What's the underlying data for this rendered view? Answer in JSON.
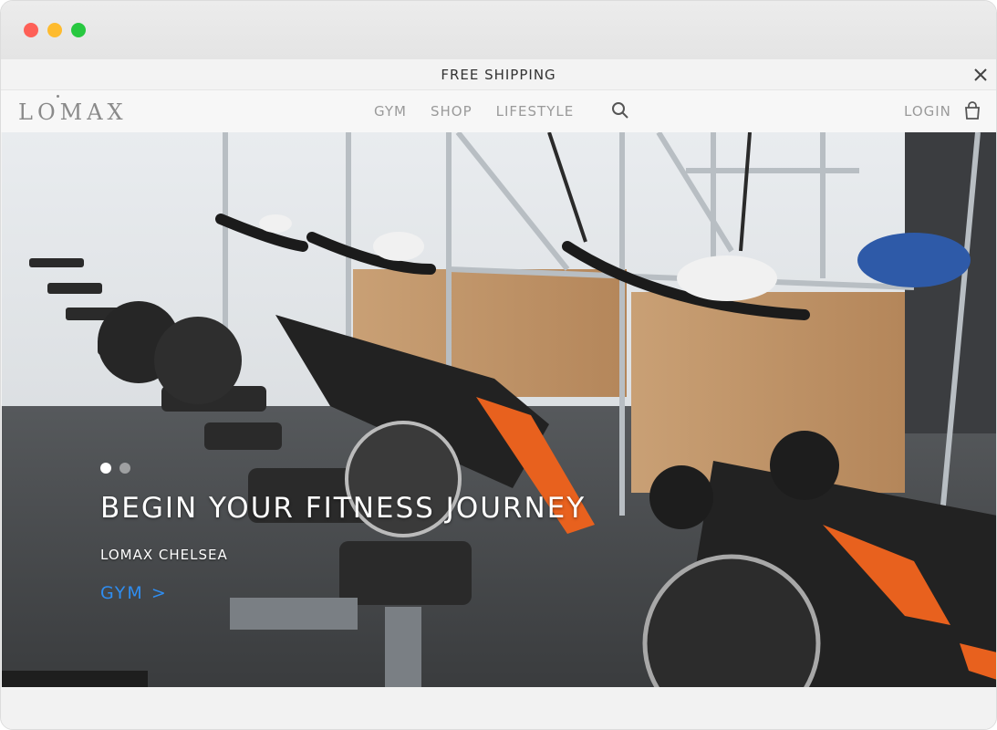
{
  "promo": {
    "text": "FREE SHIPPING"
  },
  "header": {
    "logo": "LOMAX",
    "nav": [
      "GYM",
      "SHOP",
      "LIFESTYLE"
    ],
    "login": "LOGIN"
  },
  "hero": {
    "title": "BEGIN YOUR FITNESS JOURNEY",
    "subtitle": "LOMAX CHELSEA",
    "cta": "GYM >",
    "slides": 2,
    "active_slide": 1
  },
  "colors": {
    "accent": "#2f8df0",
    "bike_orange": "#e8611e"
  },
  "icons": [
    "close-icon",
    "search-icon",
    "shopping-bag-icon"
  ]
}
